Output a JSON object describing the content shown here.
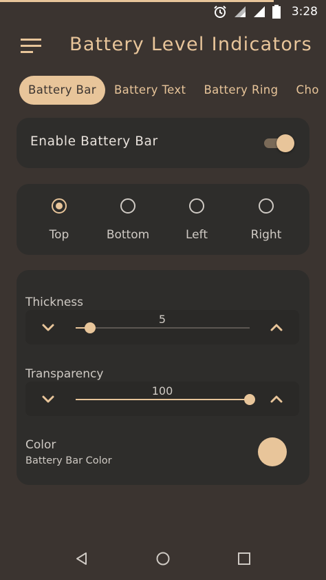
{
  "status_bar": {
    "time": "3:28",
    "icons": [
      "alarm-icon",
      "wifi-icon",
      "cell-signal-icon",
      "battery-icon"
    ]
  },
  "app_bar": {
    "title": "Battery Level Indicators",
    "menu_icon": "hamburger-menu-icon"
  },
  "tabs": [
    {
      "label": "Battery Bar",
      "active": true
    },
    {
      "label": "Battery Text",
      "active": false
    },
    {
      "label": "Battery Ring",
      "active": false
    },
    {
      "label": "Cho",
      "active": false
    }
  ],
  "enable": {
    "label": "Enable Battery Bar",
    "enabled": true
  },
  "position": {
    "options": [
      "Top",
      "Bottom",
      "Left",
      "Right"
    ],
    "selected": "Top"
  },
  "thickness": {
    "label": "Thickness",
    "value": "5",
    "min": 1,
    "max": 50,
    "current": 5
  },
  "transparency": {
    "label": "Transparency",
    "value": "100",
    "min": 0,
    "max": 100,
    "current": 100
  },
  "color": {
    "label": "Color",
    "subtitle": "Battery Bar Color",
    "value": "#e8c59a"
  },
  "theme": {
    "accent": "#e8c59a",
    "background": "#3b3430",
    "card": "#2e2d2b"
  }
}
